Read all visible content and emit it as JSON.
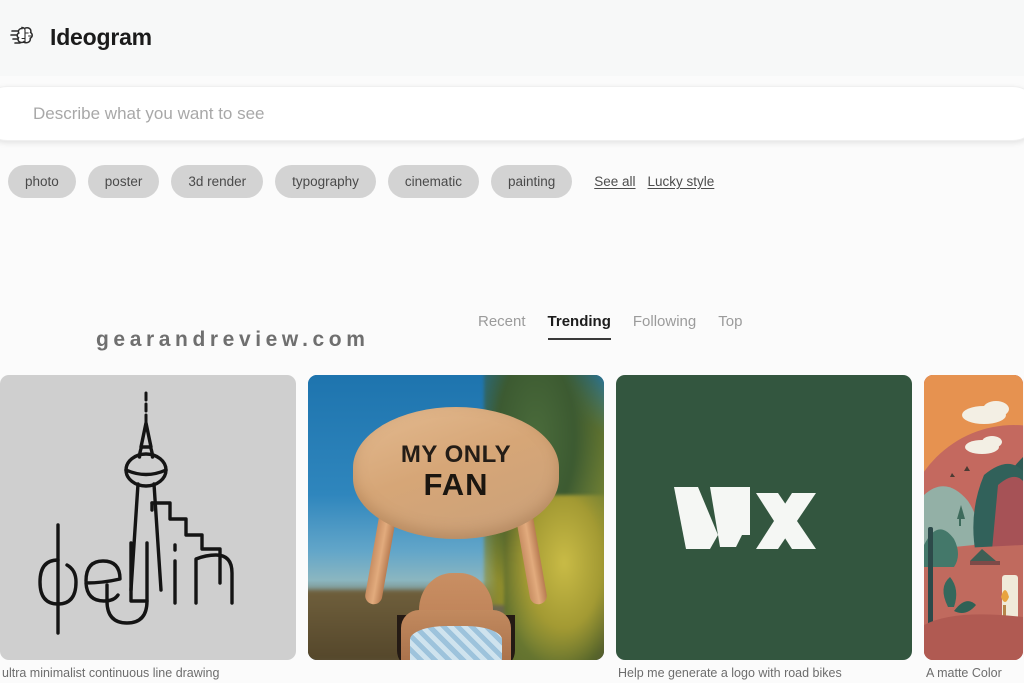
{
  "header": {
    "brand_name": "Ideogram",
    "brand_icon": "brain-icon"
  },
  "search": {
    "placeholder": "Describe what you want to see",
    "value": ""
  },
  "chips": [
    {
      "label": "photo"
    },
    {
      "label": "poster"
    },
    {
      "label": "3d render"
    },
    {
      "label": "typography"
    },
    {
      "label": "cinematic"
    },
    {
      "label": "painting"
    }
  ],
  "chip_links": [
    {
      "label": "See all"
    },
    {
      "label": "Lucky style"
    }
  ],
  "watermark": "gearandreview.com",
  "tabs": [
    {
      "label": "Recent",
      "active": false
    },
    {
      "label": "Trending",
      "active": true
    },
    {
      "label": "Following",
      "active": false
    },
    {
      "label": "Top",
      "active": false
    }
  ],
  "gallery": {
    "cards": [
      {
        "caption": "ultra minimalist continuous line drawing",
        "alt": "Berlin TV tower continuous line art on grey background",
        "bg_color": "#cfcfcf"
      },
      {
        "caption": "",
        "alt": "Woman holding a banner reading MY ONLY FAN",
        "banner_line1": "MY ONLY",
        "banner_line2": "FAN",
        "bg_color": "#2b6ea8"
      },
      {
        "caption": "Help me generate a logo with road bikes",
        "alt": "White WX monogram on dark green background",
        "logo_text": "WX",
        "bg_color": "#33563f"
      },
      {
        "caption": "A matte Color",
        "alt": "Flat illustration of a landscape with mountains and a tent",
        "bg_color": "#c4695f"
      }
    ]
  },
  "colors": {
    "page_bg": "#fbfbfb",
    "header_bg": "#f7f8f8",
    "chip_bg": "#d3d3d3",
    "tab_active": "#1d1d1d",
    "tab_inactive": "#9b9b9b",
    "card3_green": "#33563f"
  }
}
